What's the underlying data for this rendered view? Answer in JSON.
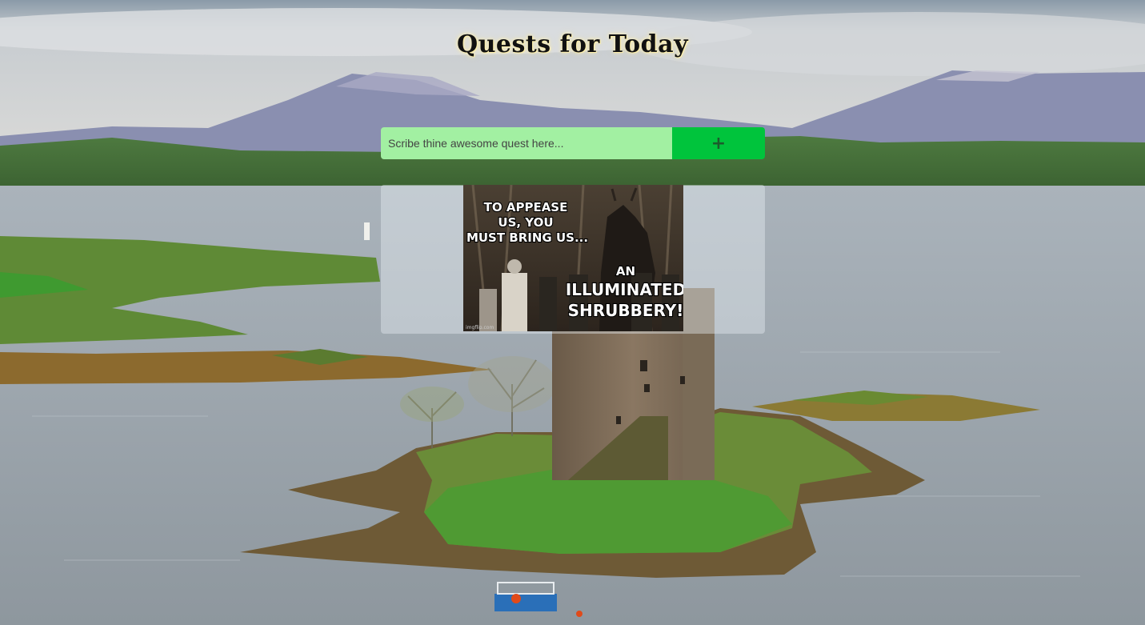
{
  "header": {
    "title": "Quests for Today"
  },
  "quest_form": {
    "input_placeholder": "Scribe thine awesome quest here...",
    "input_value": "",
    "add_label": "+"
  },
  "quest_list": {
    "meme": {
      "top_lines": [
        "TO APPEASE",
        "US, YOU",
        "MUST BRING US..."
      ],
      "bottom_lines": [
        "AN",
        "ILLUMINATED",
        "SHRUBBERY!"
      ],
      "watermark": "imgflip.com"
    }
  },
  "colors": {
    "input_bg": "#a2f0a2",
    "add_button_bg": "#00c43c",
    "title_glow": "#fff0aa",
    "panel_bg": "#e6eef2"
  }
}
